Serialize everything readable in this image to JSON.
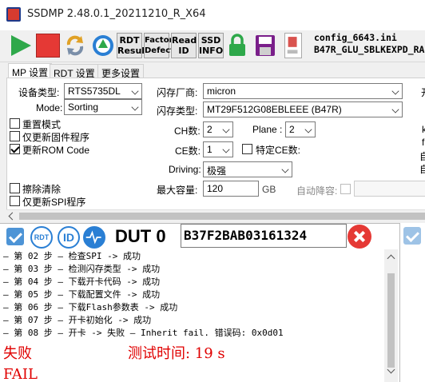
{
  "window": {
    "title": "SSDMP 2.48.0.1_20211210_R_X64"
  },
  "toolbar": {
    "buttons": [
      {
        "label": "RDT\nResult"
      },
      {
        "label": "Factory\nDefect"
      },
      {
        "label": "Read\nID"
      },
      {
        "label": "SSD\nINFO"
      }
    ],
    "config_file": "config_6643.ini",
    "config_name": "B47R_GLU_SBLKEXPD_RA"
  },
  "tabs": [
    "MP 设置",
    "RDT 设置",
    "更多设置"
  ],
  "settings": {
    "device_type_label": "设备类型:",
    "device_type_value": "RTS5735DL",
    "mode_label": "Mode:",
    "mode_value": "Sorting",
    "checkboxes": [
      {
        "label": "重置模式",
        "checked": false
      },
      {
        "label": "仅更新固件程序",
        "checked": false
      },
      {
        "label": "更新ROM Code",
        "checked": true
      }
    ],
    "flash_vendor_label": "闪存厂商:",
    "flash_vendor_value": "micron",
    "flash_type_label": "闪存类型:",
    "flash_type_value": "MT29F512G08EBLEEE (B47R)",
    "ch_label": "CH数:",
    "ch_value": "2",
    "plane_label": "Plane :",
    "plane_value": "2",
    "ce_label": "CE数:",
    "ce_value": "1",
    "specific_ce_label": "特定CE数:",
    "driving_label": "Driving:",
    "driving_value": "极强",
    "max_capacity_label": "最大容量:",
    "max_capacity_value": "120",
    "capacity_unit": "GB",
    "auto_downgrade_label": "自动降容:",
    "erase_label": "擦除清除",
    "spi_only_label": "仅更新SPI程序",
    "cut_off_right": [
      "开",
      "k",
      "f",
      "自",
      "自"
    ]
  },
  "dut": {
    "title": "DUT 0",
    "serial": "B37F2BAB03161324",
    "icons": {
      "rdt": "RDT",
      "id": "ID"
    },
    "log": [
      "— 第 02 步 — 检查SPI  -> 成功",
      "— 第 03 步 — 检测闪存类型  -> 成功",
      "— 第 04 步 — 下载开卡代码  -> 成功",
      "— 第 05 步 — 下载配置文件  -> 成功",
      "— 第 06 步 — 下载Flash参数表  -> 成功",
      "— 第 07 步 — 开卡初始化 -> 成功",
      "— 第 08 步 — 开卡  -> 失败  —  Inherit fail. 错误码: 0x0d01"
    ],
    "result_status": "失败",
    "test_time": "测试时间: 19 s",
    "result_en": "FAIL"
  },
  "colors": {
    "fail": "#e00000",
    "accent": "#2a7fd4",
    "stop": "#e53935",
    "play": "#2ea84a"
  }
}
